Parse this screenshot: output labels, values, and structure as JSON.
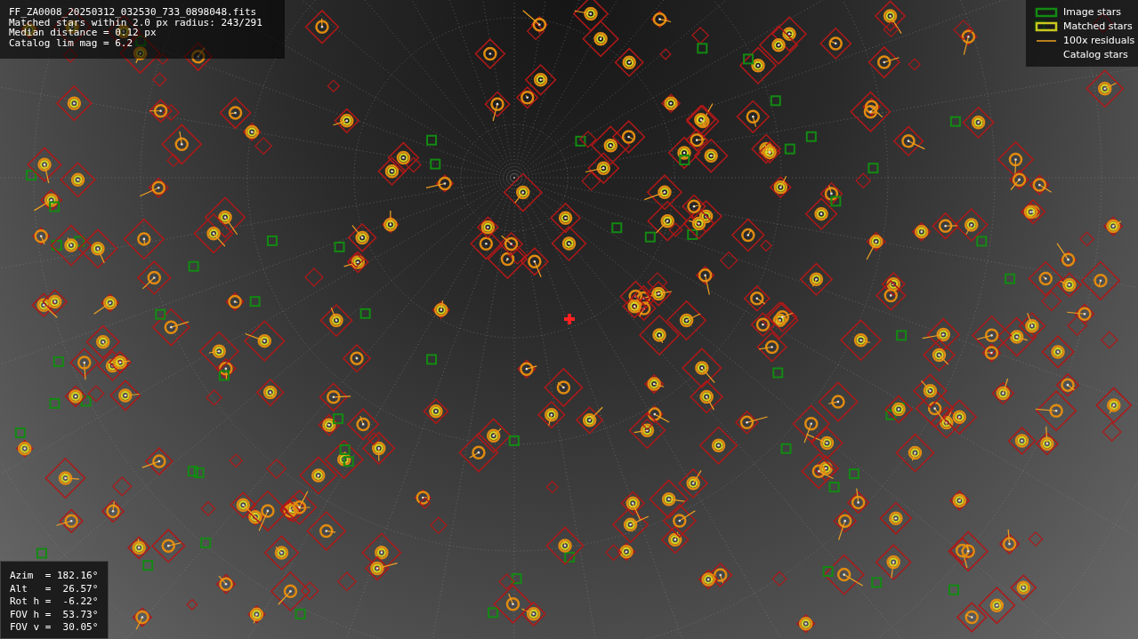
{
  "info": [
    "FF_ZA0008_20250312_032530_733_0898048.fits",
    "Matched stars within 2.0 px radius: 243/291",
    "Median distance = 0.12 px",
    "Catalog lim mag = 6.2"
  ],
  "legend": [
    {
      "kind": "image",
      "label": "Image stars"
    },
    {
      "kind": "matched",
      "label": "Matched stars"
    },
    {
      "kind": "residual",
      "label": "100x residuals"
    },
    {
      "kind": "catalog",
      "label": "Catalog stars"
    }
  ],
  "pointing": [
    "Azim  = 182.16°",
    "Alt   =  26.57°",
    "Rot h =  -6.22°",
    "FOV h =  53.73°",
    "FOV v =  30.05°"
  ]
}
